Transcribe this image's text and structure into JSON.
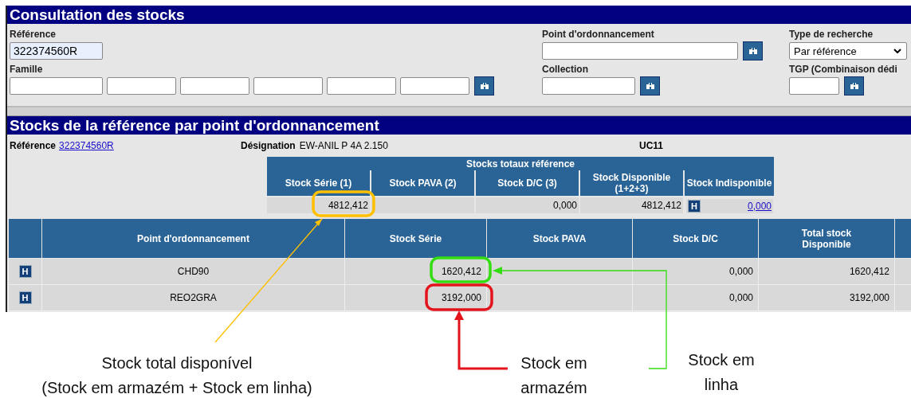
{
  "search_panel": {
    "title": "Consultation des stocks",
    "reference": {
      "label": "Référence",
      "value": "322374560R"
    },
    "famille": {
      "label": "Famille"
    },
    "point": {
      "label": "Point d'ordonnancement"
    },
    "collection": {
      "label": "Collection"
    },
    "type_recherche": {
      "label": "Type de recherche",
      "value": "Par référence"
    },
    "tgp": {
      "label": "TGP (Combinaison dédi"
    }
  },
  "results": {
    "title": "Stocks de la référence par point d'ordonnancement",
    "reference": {
      "label": "Référence",
      "value": "322374560R"
    },
    "designation": {
      "label": "Désignation",
      "value": "EW-ANIL P 4A 2.150"
    },
    "unit": "UC11",
    "totals": {
      "title": "Stocks totaux référence",
      "columns": [
        "Stock Série (1)",
        "Stock PAVA (2)",
        "Stock D/C (3)",
        "Stock Disponible (1+2+3)",
        "Stock Indisponible"
      ],
      "values": {
        "serie": "4812,412",
        "dc": "0,000",
        "disponible": "4812,412",
        "h_button": "H",
        "indisponible": "0,000"
      }
    },
    "table": {
      "columns": [
        "Point d'ordonnancement",
        "Stock Série",
        "Stock PAVA",
        "Stock D/C",
        "Total stock Disponible"
      ],
      "rows": [
        {
          "h_button": "H",
          "point": "CHD90",
          "serie": "1620,412",
          "dc": "0,000",
          "total": "1620,412"
        },
        {
          "h_button": "H",
          "point": "REO2GRA",
          "serie": "3192,000",
          "dc": "0,000",
          "total": "3192,000"
        }
      ]
    }
  },
  "annotations": [
    {
      "text": "Stock total disponível\n(Stock em armazém + Stock em linha)",
      "color": "#ffc000"
    },
    {
      "text": "Stock em\narmazém",
      "color": "#e3141b"
    },
    {
      "text": "Stock em\nlinha",
      "color": "#33dd11"
    }
  ]
}
